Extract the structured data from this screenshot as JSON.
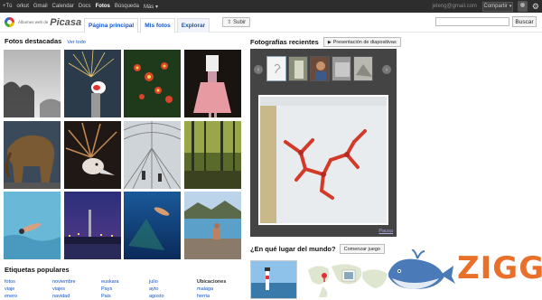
{
  "topbar": {
    "nav": [
      "+Tú",
      "orkut",
      "Gmail",
      "Calendar",
      "Docs",
      "Fotos",
      "Búsqueda",
      "Más ▾"
    ],
    "active": "Fotos",
    "account_email": "jeleng@gmail.com",
    "share_label": "Compartir",
    "share_chevron": "▾"
  },
  "header": {
    "logo_small": "Álbumes web de",
    "logo_big": "Picasa",
    "tabs": [
      "Página principal",
      "Mis fotos",
      "Explorar"
    ],
    "active_tab": "Explorar",
    "upload_label": "Subir",
    "search_placeholder": "",
    "search_button": "Buscar"
  },
  "featured": {
    "title": "Fotos destacadas",
    "see_all": "Ver todo"
  },
  "tags": {
    "title": "Etiquetas populares",
    "columns": [
      [
        "fotos",
        "viaje",
        "enero"
      ],
      [
        "noviembre",
        "viajes",
        "navidad"
      ],
      [
        "euskara",
        "Pays",
        "Pais"
      ],
      [
        "julio",
        "ayto",
        "agosto"
      ]
    ],
    "locations_header": "Ubicaciones",
    "locations": [
      "malaga",
      "herria"
    ]
  },
  "recent": {
    "title": "Fotografías recientes",
    "slideshow_label": "Presentación de diapositivas",
    "pause_label": "Pausa",
    "prev_icon": "‹",
    "next_icon": "›"
  },
  "where": {
    "title": "¿En qué lugar del mundo?",
    "play_label": "Comenzar juego"
  },
  "watermark": {
    "text": "ZIGG"
  },
  "colors": {
    "topbar": "#2d2d2d",
    "link": "#1155cc",
    "viewer_bg": "#444444",
    "watermark_blue": "#4a7ab8",
    "watermark_orange": "#e8702a"
  }
}
